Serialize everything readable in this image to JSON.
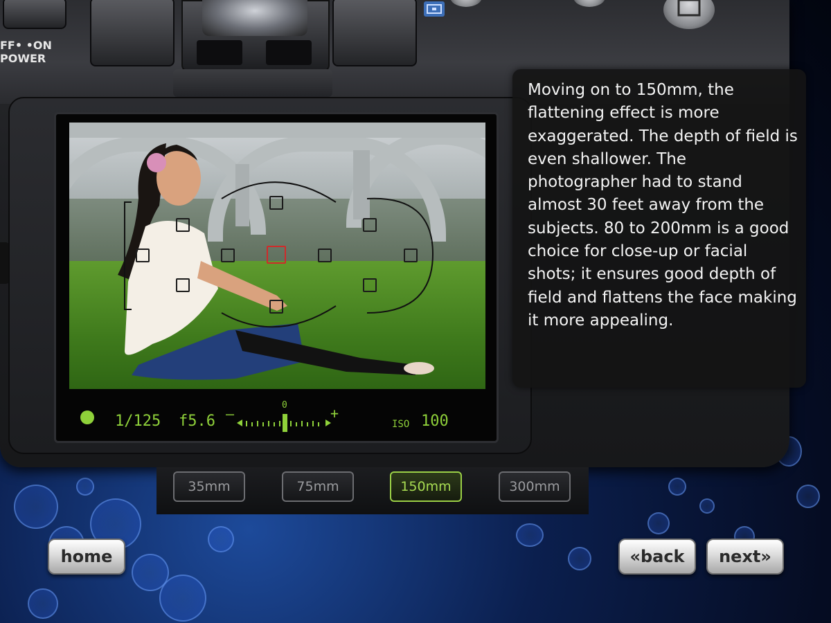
{
  "camera": {
    "power_switch_label": "FF• •ON\nPOWER"
  },
  "info_panel": {
    "text": "Moving on to 150mm, the flattening effect is more exaggerated. The depth of field is even shallower. The photographer had to stand almost 30 feet away from the subjects. 80 to 200mm is a good choice for close-up or facial shots; it ensures good depth of field and flattens the face making it more appealing."
  },
  "lcd": {
    "shutter": "1/125",
    "aperture": "f5.6",
    "exposure_scale_zero": "0",
    "exposure_minus": "–",
    "exposure_plus": "+",
    "iso_label": "ISO",
    "iso_value": "100",
    "status_color": "#8fd13a"
  },
  "lens_options": [
    {
      "label": "35mm",
      "selected": false
    },
    {
      "label": "75mm",
      "selected": false
    },
    {
      "label": "150mm",
      "selected": true
    },
    {
      "label": "300mm",
      "selected": false
    }
  ],
  "navigation": {
    "home": "home",
    "back": "«back",
    "next": "next»"
  },
  "colors": {
    "accent_green": "#9bd046",
    "af_active": "#d02a2a"
  }
}
